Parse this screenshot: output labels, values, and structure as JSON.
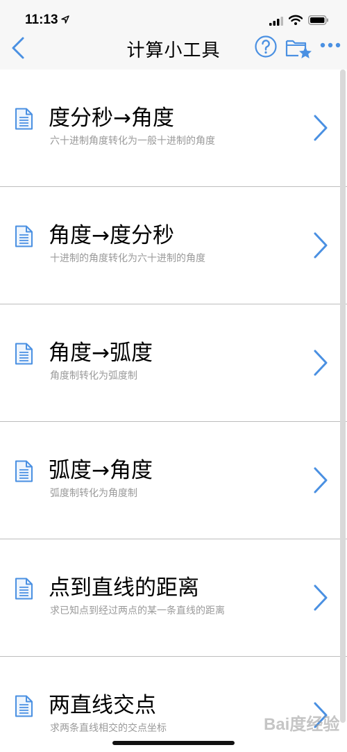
{
  "status_bar": {
    "time": "11:13"
  },
  "nav": {
    "title": "计算小工具",
    "back_icon": "chevron-left-icon",
    "help_icon": "question-circle-icon",
    "folder_icon": "folder-star-icon",
    "more_icon": "ellipsis-icon"
  },
  "colors": {
    "accent": "#4a90e2",
    "subtitle": "#9a9a9a",
    "divider": "#bdbdbd",
    "nav_bg": "#f7f7f7"
  },
  "items": [
    {
      "title": "度分秒→角度",
      "subtitle": "六十进制角度转化为一般十进制的角度",
      "icon": "document-icon"
    },
    {
      "title": "角度→度分秒",
      "subtitle": "十进制的角度转化为六十进制的角度",
      "icon": "document-icon"
    },
    {
      "title": "角度→弧度",
      "subtitle": "角度制转化为弧度制",
      "icon": "document-icon"
    },
    {
      "title": "弧度→角度",
      "subtitle": "弧度制转化为角度制",
      "icon": "document-icon"
    },
    {
      "title": "点到直线的距离",
      "subtitle": "求已知点到经过两点的某一条直线的距离",
      "icon": "document-icon"
    },
    {
      "title": "两直线交点",
      "subtitle": "求两条直线相交的交点坐标",
      "icon": "document-icon"
    }
  ],
  "watermark": "Bai度经验"
}
